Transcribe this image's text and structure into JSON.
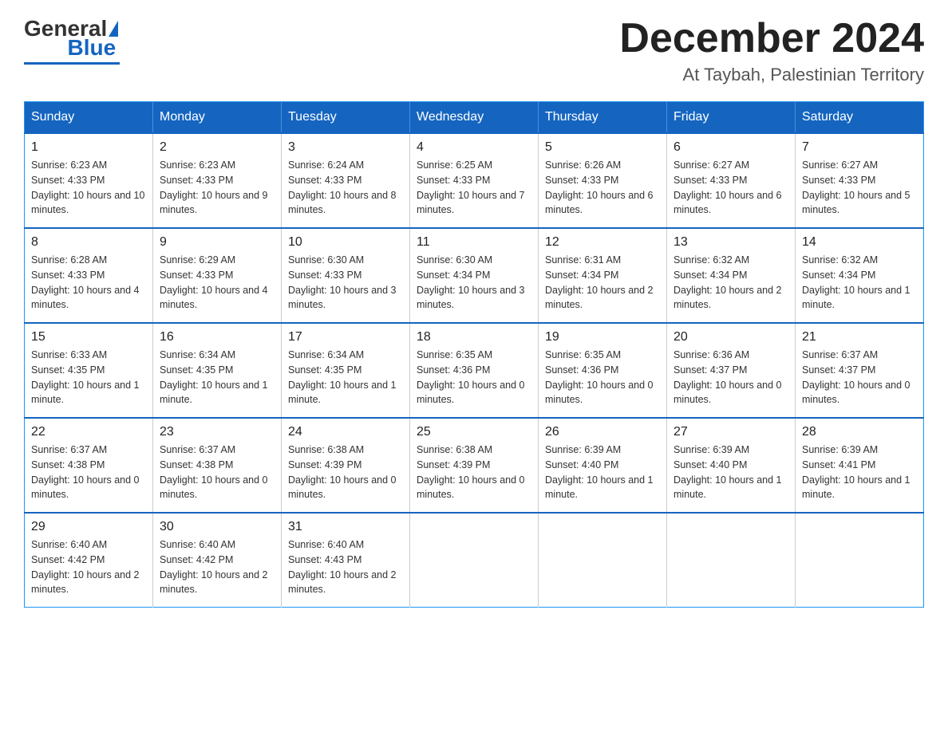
{
  "logo": {
    "general": "General",
    "blue": "Blue"
  },
  "header": {
    "month": "December 2024",
    "location": "At Taybah, Palestinian Territory"
  },
  "weekdays": [
    "Sunday",
    "Monday",
    "Tuesday",
    "Wednesday",
    "Thursday",
    "Friday",
    "Saturday"
  ],
  "weeks": [
    [
      {
        "day": "1",
        "sunrise": "6:23 AM",
        "sunset": "4:33 PM",
        "daylight": "10 hours and 10 minutes."
      },
      {
        "day": "2",
        "sunrise": "6:23 AM",
        "sunset": "4:33 PM",
        "daylight": "10 hours and 9 minutes."
      },
      {
        "day": "3",
        "sunrise": "6:24 AM",
        "sunset": "4:33 PM",
        "daylight": "10 hours and 8 minutes."
      },
      {
        "day": "4",
        "sunrise": "6:25 AM",
        "sunset": "4:33 PM",
        "daylight": "10 hours and 7 minutes."
      },
      {
        "day": "5",
        "sunrise": "6:26 AM",
        "sunset": "4:33 PM",
        "daylight": "10 hours and 6 minutes."
      },
      {
        "day": "6",
        "sunrise": "6:27 AM",
        "sunset": "4:33 PM",
        "daylight": "10 hours and 6 minutes."
      },
      {
        "day": "7",
        "sunrise": "6:27 AM",
        "sunset": "4:33 PM",
        "daylight": "10 hours and 5 minutes."
      }
    ],
    [
      {
        "day": "8",
        "sunrise": "6:28 AM",
        "sunset": "4:33 PM",
        "daylight": "10 hours and 4 minutes."
      },
      {
        "day": "9",
        "sunrise": "6:29 AM",
        "sunset": "4:33 PM",
        "daylight": "10 hours and 4 minutes."
      },
      {
        "day": "10",
        "sunrise": "6:30 AM",
        "sunset": "4:33 PM",
        "daylight": "10 hours and 3 minutes."
      },
      {
        "day": "11",
        "sunrise": "6:30 AM",
        "sunset": "4:34 PM",
        "daylight": "10 hours and 3 minutes."
      },
      {
        "day": "12",
        "sunrise": "6:31 AM",
        "sunset": "4:34 PM",
        "daylight": "10 hours and 2 minutes."
      },
      {
        "day": "13",
        "sunrise": "6:32 AM",
        "sunset": "4:34 PM",
        "daylight": "10 hours and 2 minutes."
      },
      {
        "day": "14",
        "sunrise": "6:32 AM",
        "sunset": "4:34 PM",
        "daylight": "10 hours and 1 minute."
      }
    ],
    [
      {
        "day": "15",
        "sunrise": "6:33 AM",
        "sunset": "4:35 PM",
        "daylight": "10 hours and 1 minute."
      },
      {
        "day": "16",
        "sunrise": "6:34 AM",
        "sunset": "4:35 PM",
        "daylight": "10 hours and 1 minute."
      },
      {
        "day": "17",
        "sunrise": "6:34 AM",
        "sunset": "4:35 PM",
        "daylight": "10 hours and 1 minute."
      },
      {
        "day": "18",
        "sunrise": "6:35 AM",
        "sunset": "4:36 PM",
        "daylight": "10 hours and 0 minutes."
      },
      {
        "day": "19",
        "sunrise": "6:35 AM",
        "sunset": "4:36 PM",
        "daylight": "10 hours and 0 minutes."
      },
      {
        "day": "20",
        "sunrise": "6:36 AM",
        "sunset": "4:37 PM",
        "daylight": "10 hours and 0 minutes."
      },
      {
        "day": "21",
        "sunrise": "6:37 AM",
        "sunset": "4:37 PM",
        "daylight": "10 hours and 0 minutes."
      }
    ],
    [
      {
        "day": "22",
        "sunrise": "6:37 AM",
        "sunset": "4:38 PM",
        "daylight": "10 hours and 0 minutes."
      },
      {
        "day": "23",
        "sunrise": "6:37 AM",
        "sunset": "4:38 PM",
        "daylight": "10 hours and 0 minutes."
      },
      {
        "day": "24",
        "sunrise": "6:38 AM",
        "sunset": "4:39 PM",
        "daylight": "10 hours and 0 minutes."
      },
      {
        "day": "25",
        "sunrise": "6:38 AM",
        "sunset": "4:39 PM",
        "daylight": "10 hours and 0 minutes."
      },
      {
        "day": "26",
        "sunrise": "6:39 AM",
        "sunset": "4:40 PM",
        "daylight": "10 hours and 1 minute."
      },
      {
        "day": "27",
        "sunrise": "6:39 AM",
        "sunset": "4:40 PM",
        "daylight": "10 hours and 1 minute."
      },
      {
        "day": "28",
        "sunrise": "6:39 AM",
        "sunset": "4:41 PM",
        "daylight": "10 hours and 1 minute."
      }
    ],
    [
      {
        "day": "29",
        "sunrise": "6:40 AM",
        "sunset": "4:42 PM",
        "daylight": "10 hours and 2 minutes."
      },
      {
        "day": "30",
        "sunrise": "6:40 AM",
        "sunset": "4:42 PM",
        "daylight": "10 hours and 2 minutes."
      },
      {
        "day": "31",
        "sunrise": "6:40 AM",
        "sunset": "4:43 PM",
        "daylight": "10 hours and 2 minutes."
      },
      null,
      null,
      null,
      null
    ]
  ]
}
